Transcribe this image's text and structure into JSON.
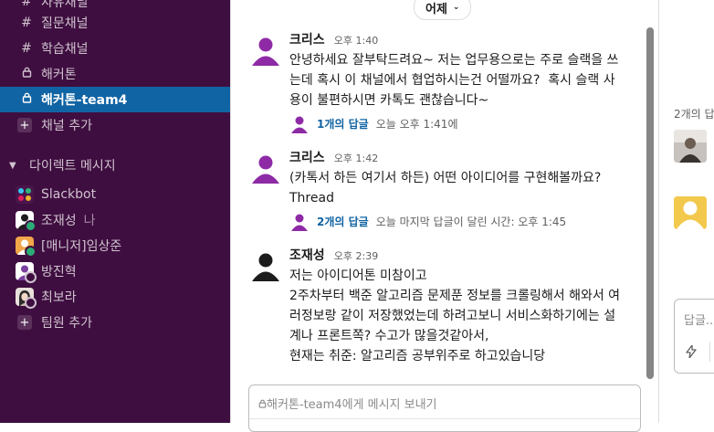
{
  "sidebar": {
    "channels": [
      {
        "label": "자유채널",
        "prefix": "#"
      },
      {
        "label": "질문채널",
        "prefix": "#"
      },
      {
        "label": "학습채널",
        "prefix": "#"
      },
      {
        "label": "해커톤",
        "prefix": "lock"
      },
      {
        "label": "해커톤-team4",
        "prefix": "lock",
        "active": true
      }
    ],
    "add_channel": "채널 추가",
    "dm_header": "다이렉트 메시지",
    "dms": [
      {
        "label": "Slackbot",
        "suffix": ""
      },
      {
        "label": "조재성",
        "suffix": "나"
      },
      {
        "label": "[매니저]임상준",
        "suffix": ""
      },
      {
        "label": "방진혁",
        "suffix": ""
      },
      {
        "label": "최보라",
        "suffix": ""
      }
    ],
    "add_member": "팀원 추가",
    "colors": {
      "background": "#3f0e40",
      "active": "#1164a3",
      "text": "#cfc3cf"
    }
  },
  "main": {
    "date_divider": "어제",
    "messages": [
      {
        "author": "크리스",
        "time": "오후 1:40",
        "text": "안녕하세요 잘부탁드려요~ 저는 업무용으로는 주로 슬랙을 쓰\n는데 혹시 이 채널에서 협업하시는건 어떨까요?  혹시 슬랙 사\n용이 불편하시면 카톡도 괜찮습니다~",
        "thread": {
          "reply_count": "1개의 답글",
          "last_reply": "오늘 오후 1:41에"
        }
      },
      {
        "author": "크리스",
        "time": "오후 1:42",
        "text": "(카톡서 하든 여기서 하든) 어떤 아이디어를 구현해볼까요?\nThread",
        "thread": {
          "reply_count": "2개의 답글",
          "last_reply": "오늘 마지막 답글이 달린 시간: 오후 1:45"
        }
      },
      {
        "author": "조재성",
        "time": "오후 2:39",
        "text": "저는 아이디어톤 미참이고\n2주차부터 백준 알고리즘 문제푼 정보를 크롤링해서 해와서 여\n러정보랑 같이 저장했었는데 하려고보니 서비스화하기에는 설\n계나 프론트쪽? 수고가 많을것같아서,\n현재는 취준: 알고리즘 공부위주로 하고있습니당"
      }
    ],
    "composer_placeholder": "해커톤-team4에게 메시지 보내기"
  },
  "right_panel": {
    "replies_text": "2개의 답",
    "input_placeholder": "답글..."
  }
}
